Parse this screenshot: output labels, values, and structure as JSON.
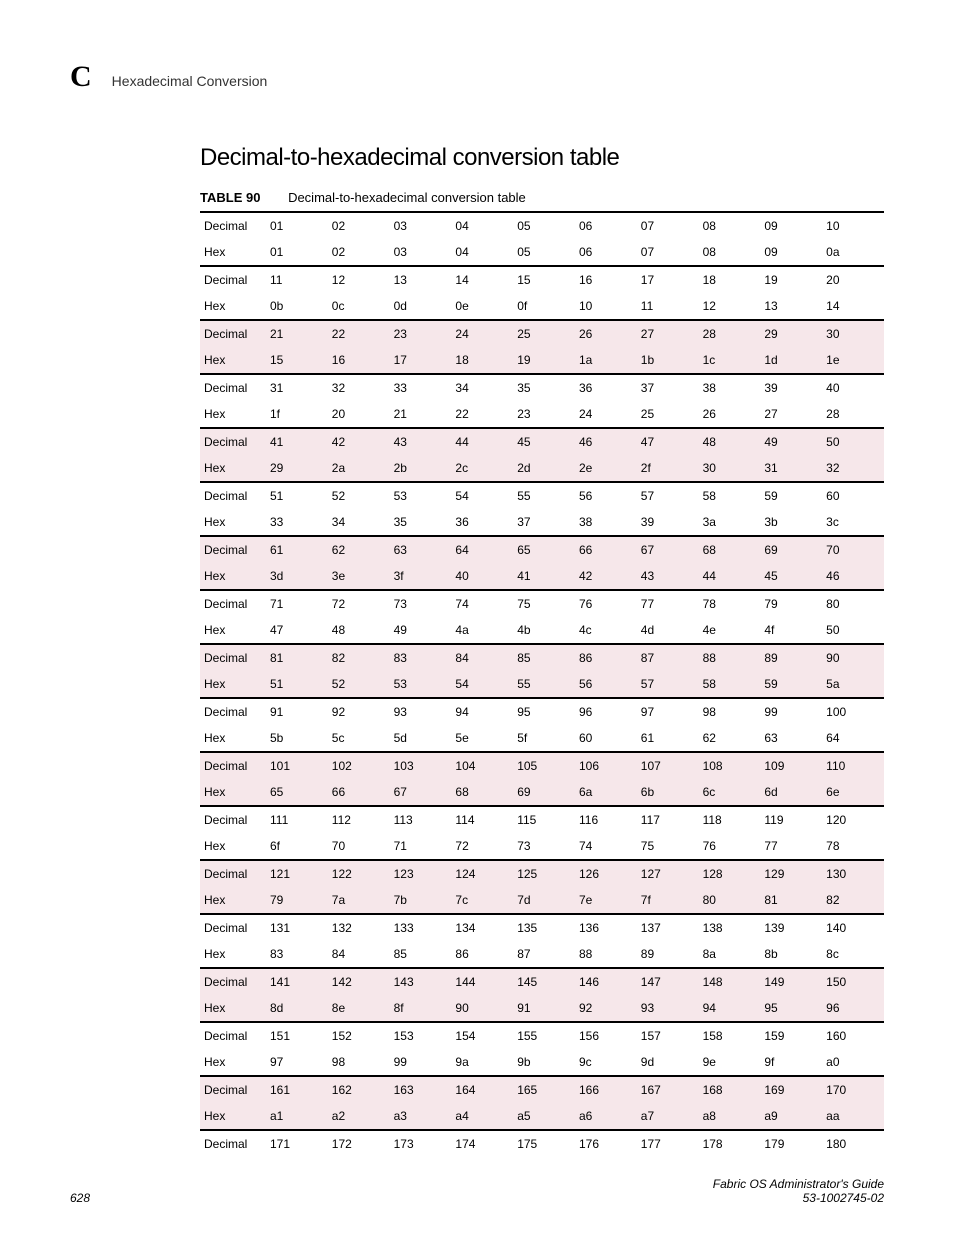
{
  "header": {
    "letter": "C",
    "text": "Hexadecimal Conversion"
  },
  "section_title": "Decimal-to-hexadecimal conversion table",
  "table_caption": {
    "label": "TABLE 90",
    "title": "Decimal-to-hexadecimal conversion table"
  },
  "row_labels": {
    "decimal": "Decimal",
    "hex": "Hex"
  },
  "blocks": [
    {
      "shaded": false,
      "dec": [
        "01",
        "02",
        "03",
        "04",
        "05",
        "06",
        "07",
        "08",
        "09",
        "10"
      ],
      "hex": [
        "01",
        "02",
        "03",
        "04",
        "05",
        "06",
        "07",
        "08",
        "09",
        "0a"
      ]
    },
    {
      "shaded": false,
      "dec": [
        "11",
        "12",
        "13",
        "14",
        "15",
        "16",
        "17",
        "18",
        "19",
        "20"
      ],
      "hex": [
        "0b",
        "0c",
        "0d",
        "0e",
        "0f",
        "10",
        "11",
        "12",
        "13",
        "14"
      ]
    },
    {
      "shaded": true,
      "dec": [
        "21",
        "22",
        "23",
        "24",
        "25",
        "26",
        "27",
        "28",
        "29",
        "30"
      ],
      "hex": [
        "15",
        "16",
        "17",
        "18",
        "19",
        "1a",
        "1b",
        "1c",
        "1d",
        "1e"
      ]
    },
    {
      "shaded": false,
      "dec": [
        "31",
        "32",
        "33",
        "34",
        "35",
        "36",
        "37",
        "38",
        "39",
        "40"
      ],
      "hex": [
        "1f",
        "20",
        "21",
        "22",
        "23",
        "24",
        "25",
        "26",
        "27",
        "28"
      ]
    },
    {
      "shaded": true,
      "dec": [
        "41",
        "42",
        "43",
        "44",
        "45",
        "46",
        "47",
        "48",
        "49",
        "50"
      ],
      "hex": [
        "29",
        "2a",
        "2b",
        "2c",
        "2d",
        "2e",
        "2f",
        "30",
        "31",
        "32"
      ]
    },
    {
      "shaded": false,
      "dec": [
        "51",
        "52",
        "53",
        "54",
        "55",
        "56",
        "57",
        "58",
        "59",
        "60"
      ],
      "hex": [
        "33",
        "34",
        "35",
        "36",
        "37",
        "38",
        "39",
        "3a",
        "3b",
        "3c"
      ]
    },
    {
      "shaded": true,
      "dec": [
        "61",
        "62",
        "63",
        "64",
        "65",
        "66",
        "67",
        "68",
        "69",
        "70"
      ],
      "hex": [
        "3d",
        "3e",
        "3f",
        "40",
        "41",
        "42",
        "43",
        "44",
        "45",
        "46"
      ]
    },
    {
      "shaded": false,
      "dec": [
        "71",
        "72",
        "73",
        "74",
        "75",
        "76",
        "77",
        "78",
        "79",
        "80"
      ],
      "hex": [
        "47",
        "48",
        "49",
        "4a",
        "4b",
        "4c",
        "4d",
        "4e",
        "4f",
        "50"
      ]
    },
    {
      "shaded": true,
      "dec": [
        "81",
        "82",
        "83",
        "84",
        "85",
        "86",
        "87",
        "88",
        "89",
        "90"
      ],
      "hex": [
        "51",
        "52",
        "53",
        "54",
        "55",
        "56",
        "57",
        "58",
        "59",
        "5a"
      ]
    },
    {
      "shaded": false,
      "dec": [
        "91",
        "92",
        "93",
        "94",
        "95",
        "96",
        "97",
        "98",
        "99",
        "100"
      ],
      "hex": [
        "5b",
        "5c",
        "5d",
        "5e",
        "5f",
        "60",
        "61",
        "62",
        "63",
        "64"
      ]
    },
    {
      "shaded": true,
      "dec": [
        "101",
        "102",
        "103",
        "104",
        "105",
        "106",
        "107",
        "108",
        "109",
        "110"
      ],
      "hex": [
        "65",
        "66",
        "67",
        "68",
        "69",
        "6a",
        "6b",
        "6c",
        "6d",
        "6e"
      ]
    },
    {
      "shaded": false,
      "dec": [
        "111",
        "112",
        "113",
        "114",
        "115",
        "116",
        "117",
        "118",
        "119",
        "120"
      ],
      "hex": [
        "6f",
        "70",
        "71",
        "72",
        "73",
        "74",
        "75",
        "76",
        "77",
        "78"
      ]
    },
    {
      "shaded": true,
      "dec": [
        "121",
        "122",
        "123",
        "124",
        "125",
        "126",
        "127",
        "128",
        "129",
        "130"
      ],
      "hex": [
        "79",
        "7a",
        "7b",
        "7c",
        "7d",
        "7e",
        "7f",
        "80",
        "81",
        "82"
      ]
    },
    {
      "shaded": false,
      "dec": [
        "131",
        "132",
        "133",
        "134",
        "135",
        "136",
        "137",
        "138",
        "139",
        "140"
      ],
      "hex": [
        "83",
        "84",
        "85",
        "86",
        "87",
        "88",
        "89",
        "8a",
        "8b",
        "8c"
      ]
    },
    {
      "shaded": true,
      "dec": [
        "141",
        "142",
        "143",
        "144",
        "145",
        "146",
        "147",
        "148",
        "149",
        "150"
      ],
      "hex": [
        "8d",
        "8e",
        "8f",
        "90",
        "91",
        "92",
        "93",
        "94",
        "95",
        "96"
      ]
    },
    {
      "shaded": false,
      "dec": [
        "151",
        "152",
        "153",
        "154",
        "155",
        "156",
        "157",
        "158",
        "159",
        "160"
      ],
      "hex": [
        "97",
        "98",
        "99",
        "9a",
        "9b",
        "9c",
        "9d",
        "9e",
        "9f",
        "a0"
      ]
    },
    {
      "shaded": true,
      "dec": [
        "161",
        "162",
        "163",
        "164",
        "165",
        "166",
        "167",
        "168",
        "169",
        "170"
      ],
      "hex": [
        "a1",
        "a2",
        "a3",
        "a4",
        "a5",
        "a6",
        "a7",
        "a8",
        "a9",
        "aa"
      ]
    },
    {
      "shaded": false,
      "dec": [
        "171",
        "172",
        "173",
        "174",
        "175",
        "176",
        "177",
        "178",
        "179",
        "180"
      ],
      "hex": null
    }
  ],
  "footer": {
    "page": "628",
    "title": "Fabric OS Administrator's Guide",
    "doc_id": "53-1002745-02"
  }
}
